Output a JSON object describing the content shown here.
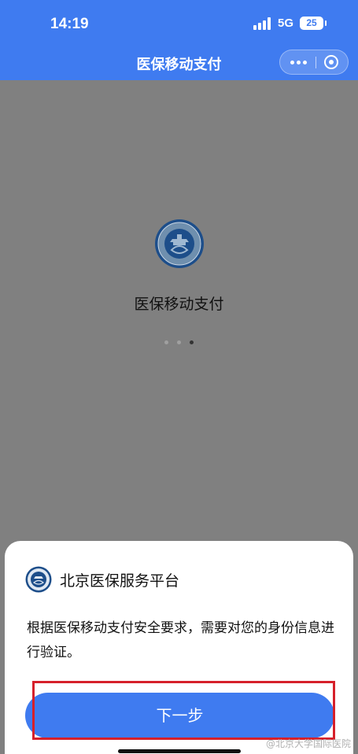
{
  "status_bar": {
    "time": "14:19",
    "network": "5G",
    "battery": "25"
  },
  "nav": {
    "title": "医保移动支付",
    "more_icon": "more-dots-icon",
    "close_icon": "target-circle-icon"
  },
  "splash": {
    "title": "医保移动支付",
    "loader_dots": 3,
    "active_dot": 3,
    "logo_icon": "medical-insurance-emblem-icon"
  },
  "sheet": {
    "app_name": "北京医保服务平台",
    "description": "根据医保移动支付安全要求，需要对您的身份信息进行验证。",
    "next_button": "下一步"
  },
  "watermark": "@北京大学国际医院",
  "colors": {
    "brand_blue": "#3f7bf0",
    "overlay_gray": "#808080",
    "highlight_red": "#d6202a"
  }
}
